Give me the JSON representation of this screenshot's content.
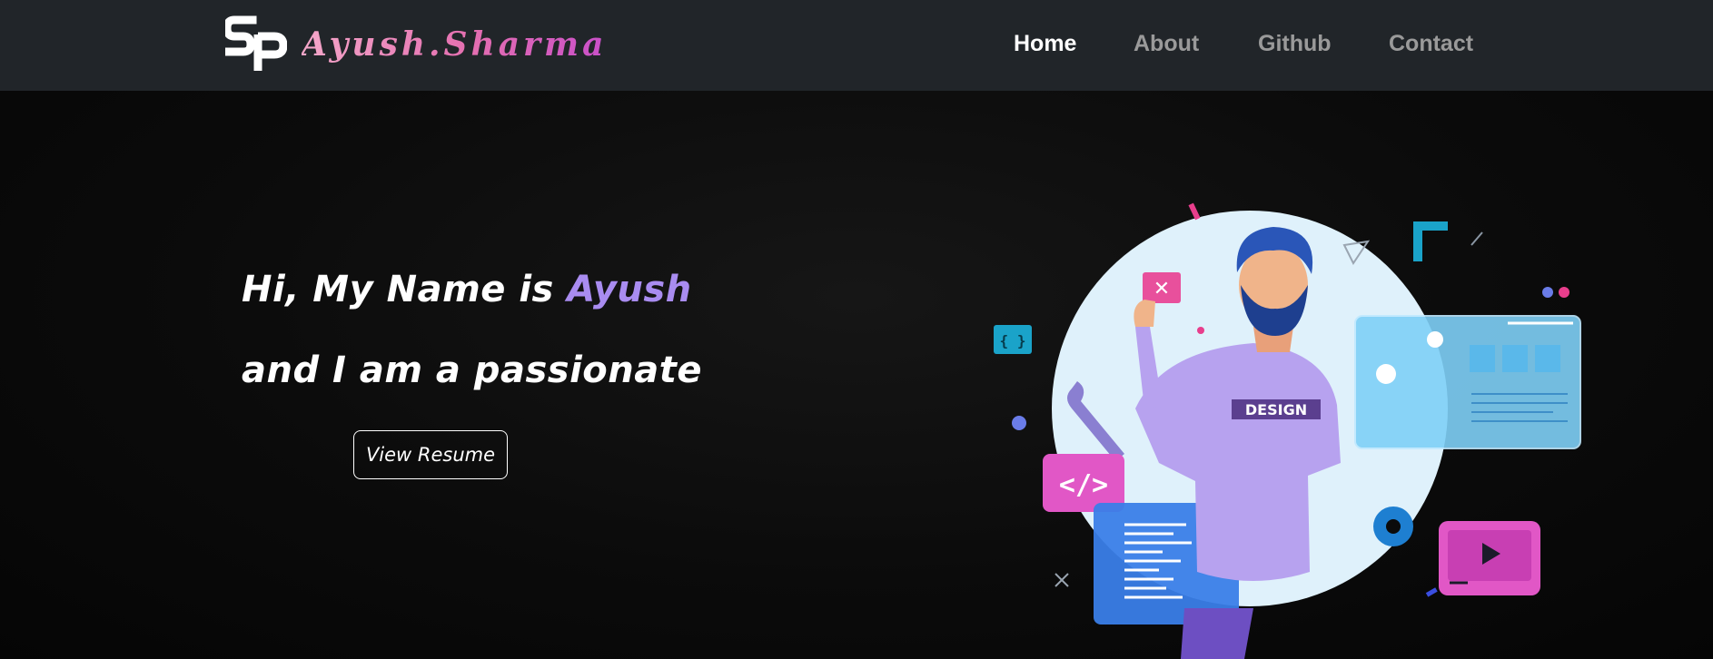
{
  "brand": {
    "name": "Ayush.Sharma",
    "logo_icon": "sp-monogram-icon"
  },
  "nav": {
    "items": [
      {
        "label": "Home",
        "active": true
      },
      {
        "label": "About",
        "active": false
      },
      {
        "label": "Github",
        "active": false
      },
      {
        "label": "Contact",
        "active": false
      }
    ]
  },
  "hero": {
    "line1_prefix": "Hi, My Name is ",
    "line1_name": "Ayush",
    "line2": "and I am a passionate",
    "button_label": "View Resume"
  },
  "illustration": {
    "badge_text": "DESIGN",
    "code_symbol": "</>",
    "close_symbol": "✕",
    "braces_symbol": "{ }"
  },
  "colors": {
    "navbar": "#212529",
    "accent_purple": "#a98cf0",
    "brand_pink": "#e46fb0"
  }
}
